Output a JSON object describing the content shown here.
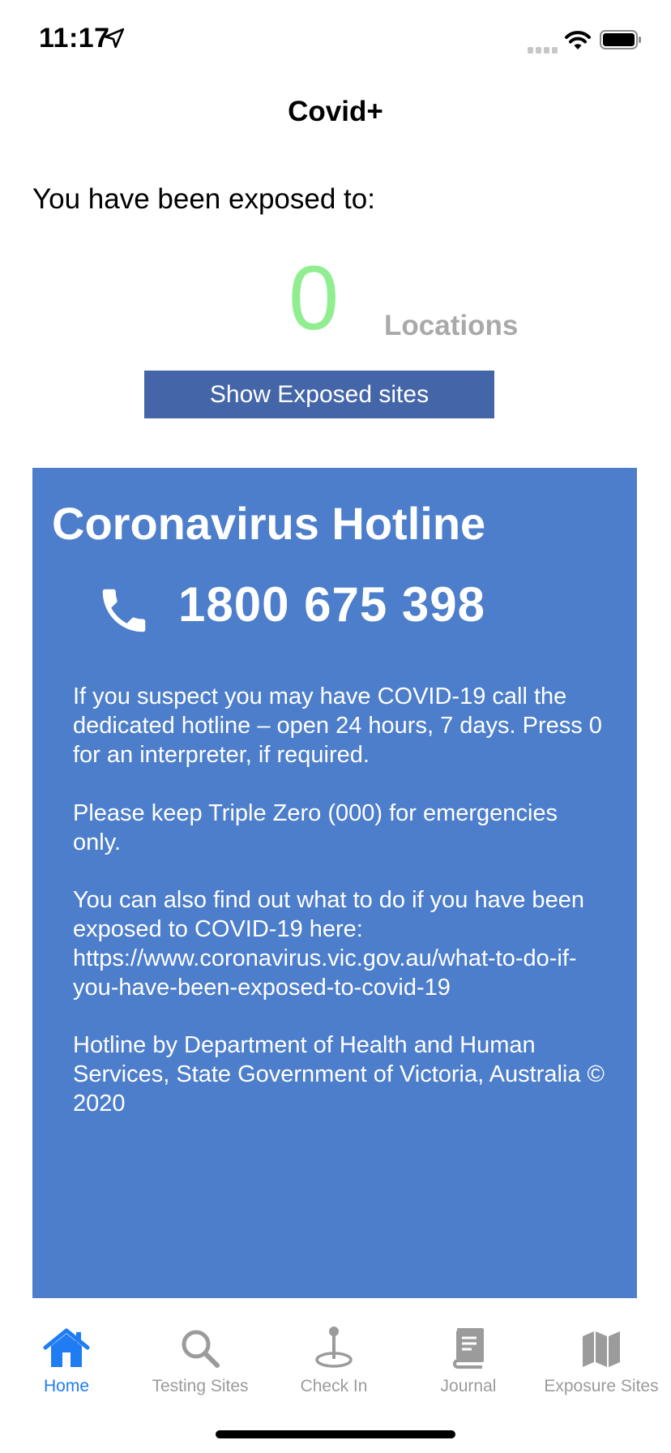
{
  "status_bar": {
    "time": "11:17"
  },
  "nav": {
    "title": "Covid+"
  },
  "exposure": {
    "label": "You have been exposed to:",
    "count": "0",
    "unit": "Locations",
    "button_label": "Show Exposed sites"
  },
  "hotline": {
    "title": "Coronavirus Hotline",
    "number": "1800 675 398",
    "paragraphs": [
      "If you suspect you may have COVID-19 call the dedicated hotline – open 24 hours, 7 days. Press 0 for an interpreter, if required.",
      "Please keep Triple Zero (000) for emergencies only.",
      "You can also find out what to do if you have been exposed to COVID-19 here: https://www.coronavirus.vic.gov.au/what-to-do-if-you-have-been-exposed-to-covid-19",
      "Hotline by Department of Health and Human Services, State Government of Victoria, Australia © 2020"
    ]
  },
  "tabs": [
    {
      "label": "Home",
      "icon": "house-icon",
      "active": true
    },
    {
      "label": "Testing Sites",
      "icon": "magnifying-glass-icon",
      "active": false
    },
    {
      "label": "Check In",
      "icon": "map-pin-icon",
      "active": false
    },
    {
      "label": "Journal",
      "icon": "book-icon",
      "active": false
    },
    {
      "label": "Exposure Sites",
      "icon": "map-icon",
      "active": false
    }
  ],
  "colors": {
    "count": "#90ee90",
    "button": "#4466a8",
    "panel": "#4d7ecb",
    "tab_active": "#1f7cf2",
    "tab_inactive": "#9b9b9b"
  }
}
